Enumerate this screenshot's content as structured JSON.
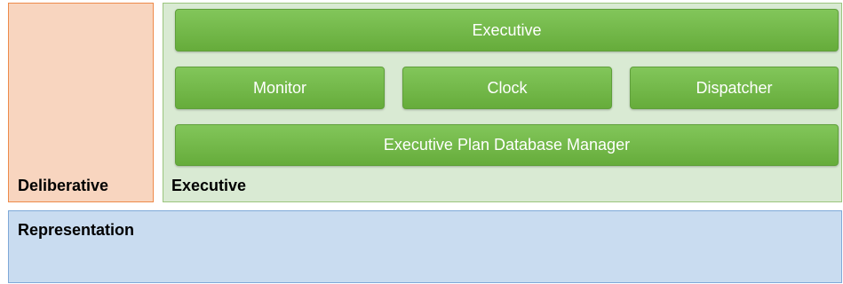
{
  "panels": {
    "deliberative": {
      "label": "Deliberative"
    },
    "executive": {
      "label": "Executive"
    },
    "representation": {
      "label": "Representation"
    }
  },
  "components": {
    "executive": "Executive",
    "monitor": "Monitor",
    "clock": "Clock",
    "dispatcher": "Dispatcher",
    "plan_db_manager": "Executive Plan Database Manager"
  },
  "colors": {
    "deliberative_fill": "#f8d5bf",
    "deliberative_border": "#ee8a4a",
    "executive_fill": "#d9ead3",
    "executive_border": "#9bc57e",
    "representation_fill": "#c9dcf0",
    "representation_border": "#7ea9d8",
    "component_fill": "#70b244"
  }
}
